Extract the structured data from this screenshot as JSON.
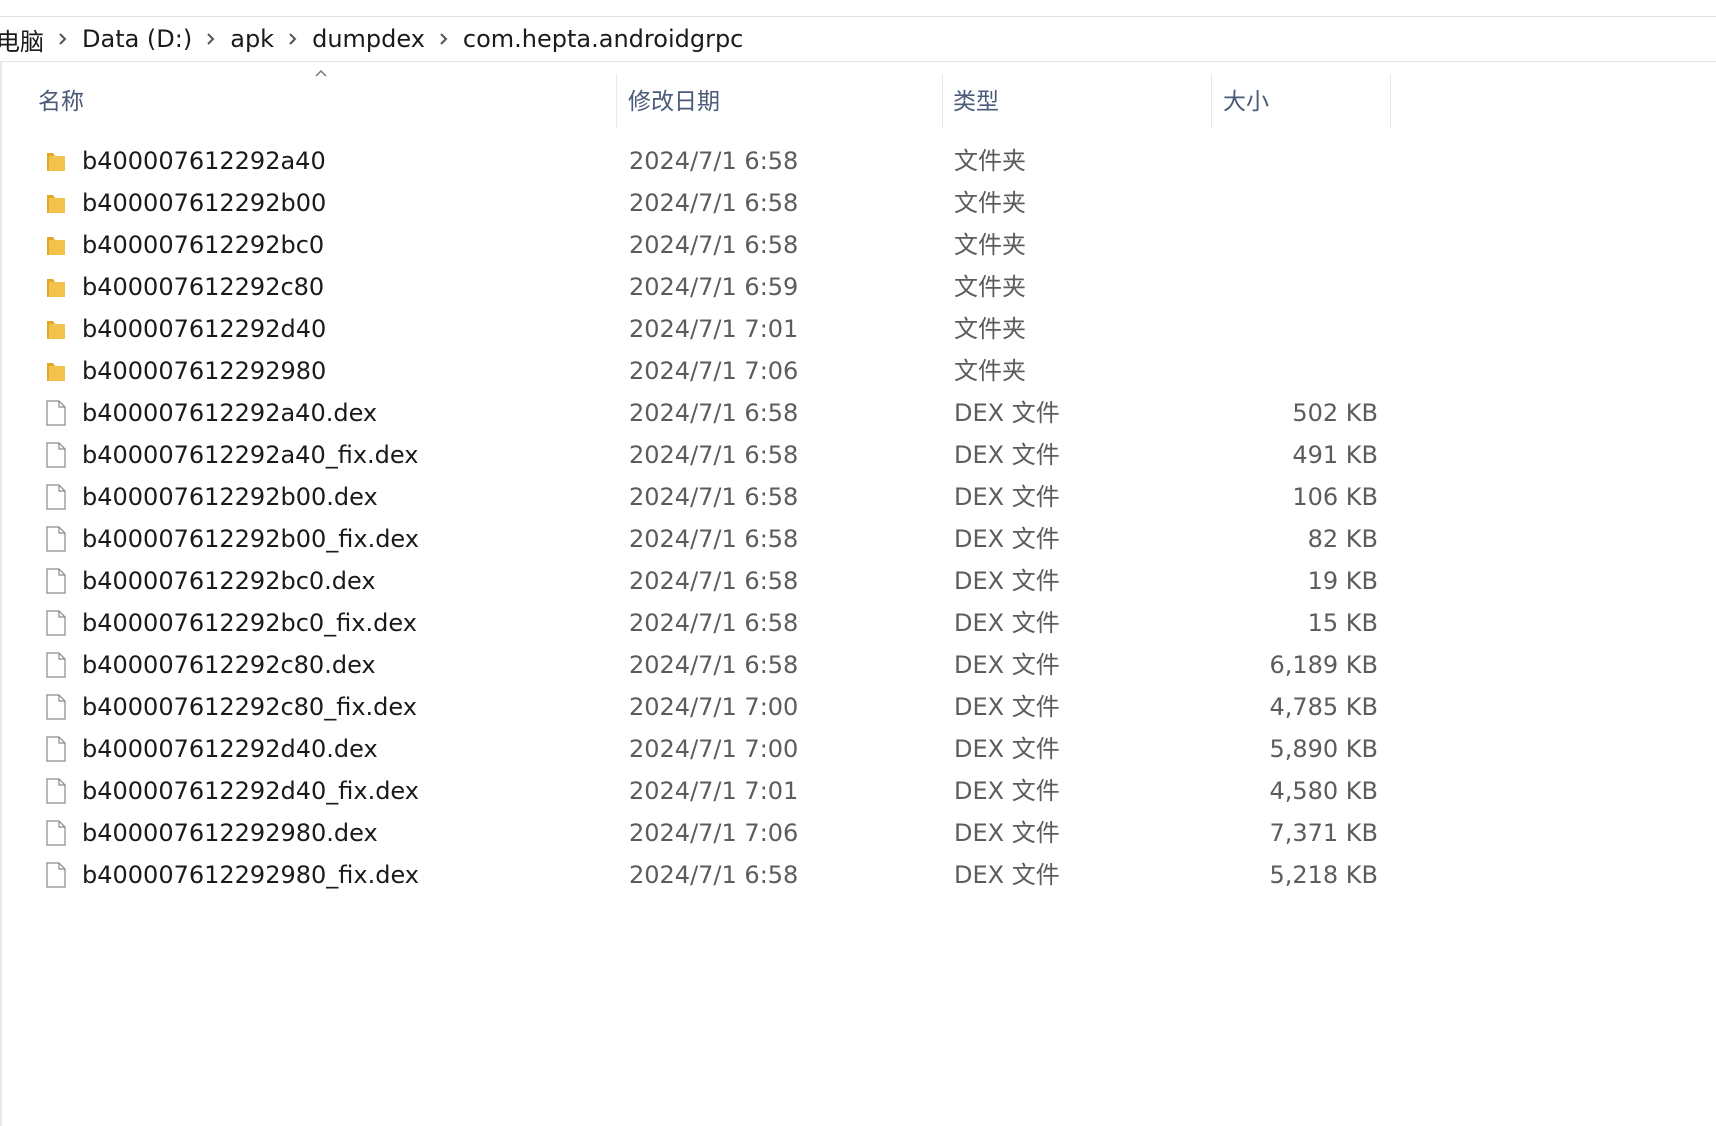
{
  "breadcrumb": {
    "items": [
      "电脑",
      "Data (D:)",
      "apk",
      "dumpdex",
      "com.hepta.androidgrpc"
    ]
  },
  "columns": {
    "name": "名称",
    "date": "修改日期",
    "type": "类型",
    "size": "大小"
  },
  "icons": {
    "folder": "folder-icon",
    "file": "file-icon",
    "separator": "chevron-right-icon",
    "sort": "sort-ascending-icon"
  },
  "colors": {
    "folder": "#f3c24a",
    "folder_dark": "#e0a825",
    "header_text": "#4a5a78"
  },
  "files": [
    {
      "name": "b400007612292a40",
      "date": "2024/7/1 6:58",
      "type": "文件夹",
      "size": "",
      "kind": "folder"
    },
    {
      "name": "b400007612292b00",
      "date": "2024/7/1 6:58",
      "type": "文件夹",
      "size": "",
      "kind": "folder"
    },
    {
      "name": "b400007612292bc0",
      "date": "2024/7/1 6:58",
      "type": "文件夹",
      "size": "",
      "kind": "folder"
    },
    {
      "name": "b400007612292c80",
      "date": "2024/7/1 6:59",
      "type": "文件夹",
      "size": "",
      "kind": "folder"
    },
    {
      "name": "b400007612292d40",
      "date": "2024/7/1 7:01",
      "type": "文件夹",
      "size": "",
      "kind": "folder"
    },
    {
      "name": "b400007612292980",
      "date": "2024/7/1 7:06",
      "type": "文件夹",
      "size": "",
      "kind": "folder"
    },
    {
      "name": "b400007612292a40.dex",
      "date": "2024/7/1 6:58",
      "type": "DEX 文件",
      "size": "502 KB",
      "kind": "file"
    },
    {
      "name": "b400007612292a40_fix.dex",
      "date": "2024/7/1 6:58",
      "type": "DEX 文件",
      "size": "491 KB",
      "kind": "file"
    },
    {
      "name": "b400007612292b00.dex",
      "date": "2024/7/1 6:58",
      "type": "DEX 文件",
      "size": "106 KB",
      "kind": "file"
    },
    {
      "name": "b400007612292b00_fix.dex",
      "date": "2024/7/1 6:58",
      "type": "DEX 文件",
      "size": "82 KB",
      "kind": "file"
    },
    {
      "name": "b400007612292bc0.dex",
      "date": "2024/7/1 6:58",
      "type": "DEX 文件",
      "size": "19 KB",
      "kind": "file"
    },
    {
      "name": "b400007612292bc0_fix.dex",
      "date": "2024/7/1 6:58",
      "type": "DEX 文件",
      "size": "15 KB",
      "kind": "file"
    },
    {
      "name": "b400007612292c80.dex",
      "date": "2024/7/1 6:58",
      "type": "DEX 文件",
      "size": "6,189 KB",
      "kind": "file"
    },
    {
      "name": "b400007612292c80_fix.dex",
      "date": "2024/7/1 7:00",
      "type": "DEX 文件",
      "size": "4,785 KB",
      "kind": "file"
    },
    {
      "name": "b400007612292d40.dex",
      "date": "2024/7/1 7:00",
      "type": "DEX 文件",
      "size": "5,890 KB",
      "kind": "file"
    },
    {
      "name": "b400007612292d40_fix.dex",
      "date": "2024/7/1 7:01",
      "type": "DEX 文件",
      "size": "4,580 KB",
      "kind": "file"
    },
    {
      "name": "b400007612292980.dex",
      "date": "2024/7/1 7:06",
      "type": "DEX 文件",
      "size": "7,371 KB",
      "kind": "file"
    },
    {
      "name": "b400007612292980_fix.dex",
      "date": "2024/7/1 6:58",
      "type": "DEX 文件",
      "size": "5,218 KB",
      "kind": "file"
    }
  ]
}
